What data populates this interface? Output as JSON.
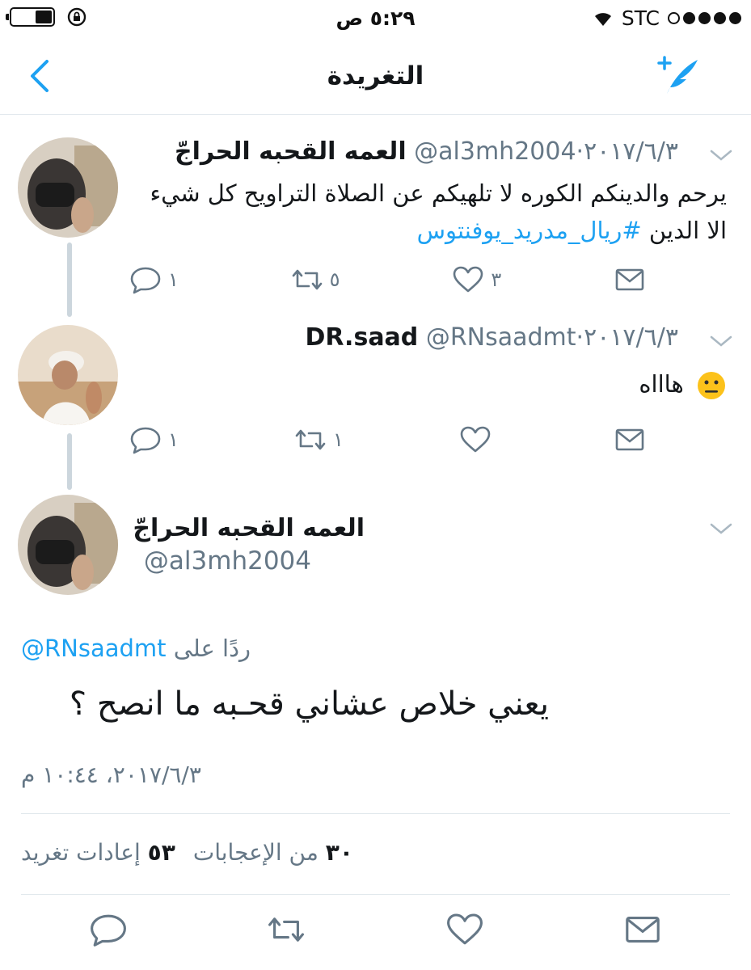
{
  "status_bar": {
    "time": "٥:٢٩ ص",
    "carrier": "STC",
    "icons": [
      "battery-icon",
      "orientation-lock-icon",
      "wifi-icon",
      "signal-dots-icon"
    ]
  },
  "nav": {
    "title": "التغريدة",
    "back_icon": "chevron-left-icon",
    "compose_icon": "compose-tweet-icon"
  },
  "tweets": [
    {
      "name": "العمه القحبه الحراجّ",
      "handle": "@al3mh2004",
      "date": "٢٠١٧/٦/٣",
      "text_line1": "يرحم والدينكم الكوره لا تلهيكم عن الصلاة التراويح كل شيء",
      "text_line2_prefix": "الا الدين",
      "hashtag": "#ريال_مدريد_يوفنتوس",
      "counts": {
        "reply": "١",
        "retweet": "٥",
        "like": "٣"
      }
    },
    {
      "name": "DR.saad",
      "handle": "@RNsaadmt",
      "date": "٢٠١٧/٦/٣",
      "text": "هاااه",
      "emoji": "neutral-face-emoji",
      "counts": {
        "reply": "١",
        "retweet": "١",
        "like": ""
      }
    }
  ],
  "main_tweet": {
    "name": "العمه القحبه الحراجّ",
    "handle": "@al3mh2004",
    "reply_to_label": "ردًا على",
    "reply_to_handle": "@RNsaadmt",
    "text": "يعني خلاص عشاني قحـ‍به ما انصح ؟",
    "timestamp": "٢٠١٧/٦/٣، ١٠:٤٤ م",
    "likes_count": "٣٠",
    "likes_label": "من الإعجابات",
    "retweets_count": "٥٣",
    "retweets_label": "إعادات تغريد"
  },
  "colors": {
    "accent": "#1da1f2",
    "secondary_text": "#657786",
    "divider": "#e1e8ed",
    "thread_line": "#ccd6dd"
  }
}
